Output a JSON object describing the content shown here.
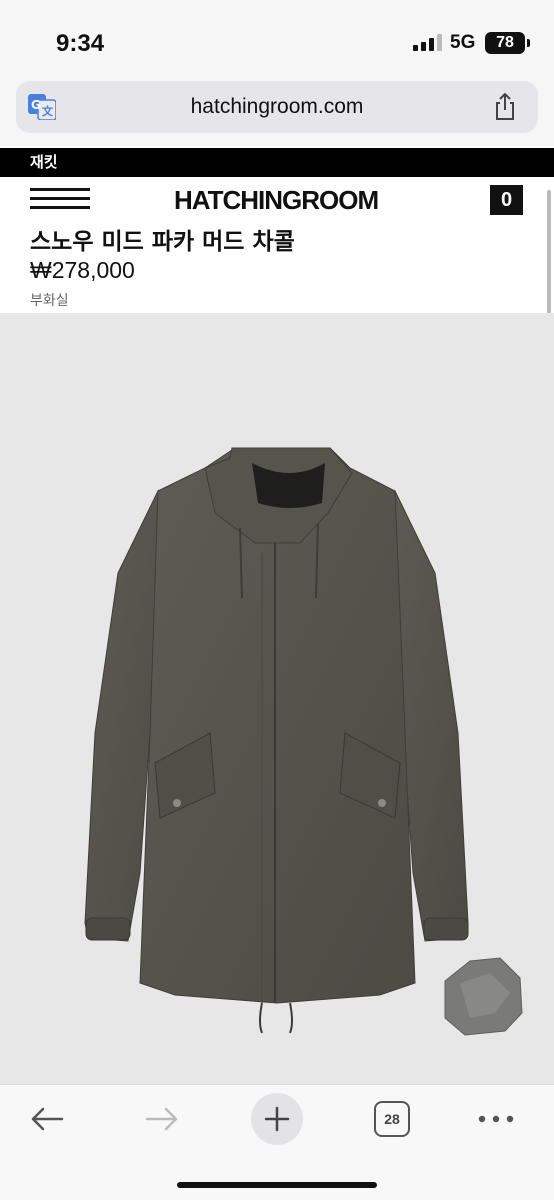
{
  "status_bar": {
    "time": "9:34",
    "network": "5G",
    "battery": "78"
  },
  "browser": {
    "url": "hatchingroom.com",
    "tab_count": "28",
    "translate_icon": "translate-icon",
    "share_icon": "share-icon",
    "back_icon": "arrow-left-icon",
    "forward_icon": "arrow-right-icon",
    "new_tab_icon": "plus-icon",
    "more_icon": "ellipsis-icon"
  },
  "site": {
    "category": "재킷",
    "logo": "HATCHINGROOM",
    "cart_count": "0"
  },
  "product": {
    "title": "스노우 미드 파카 머드 차콜",
    "price": "₩278,000",
    "color": "부화실"
  },
  "colors": {
    "jacket": "#55544c",
    "background": "#e7e7e7",
    "header_black": "#000000"
  }
}
